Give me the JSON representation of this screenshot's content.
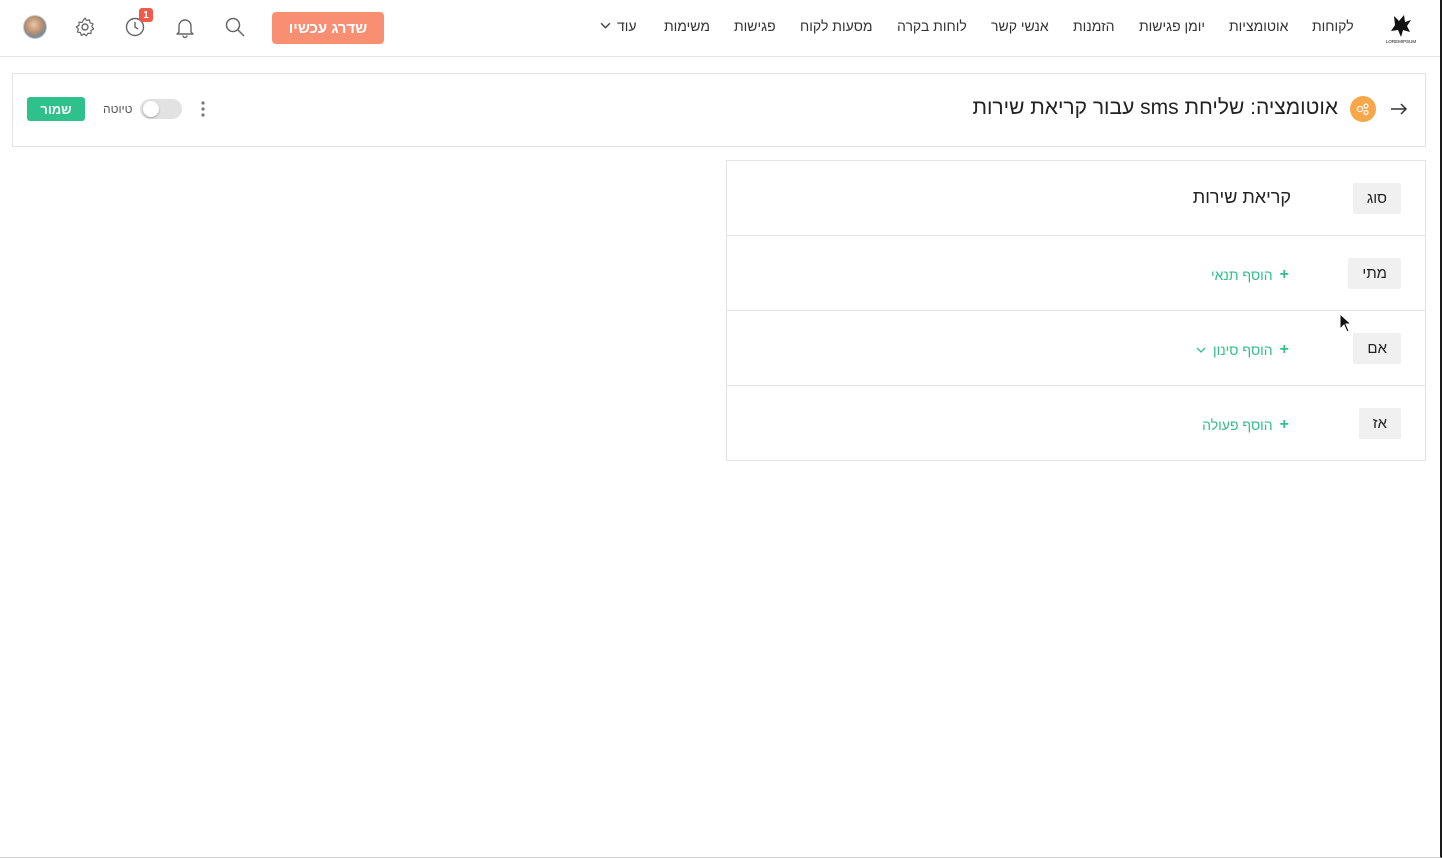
{
  "nav": {
    "items": [
      "לקוחות",
      "אוטומציות",
      "יומן פגישות",
      "הזמנות",
      "אנשי קשר",
      "לוחות בקרה",
      "מסעות לקוח",
      "פגישות",
      "משימות"
    ],
    "more_label": "עוד",
    "upgrade_label": "שדרג עכשיו",
    "notification_badge": "1",
    "logo_text": "LOREMIPSUM"
  },
  "header": {
    "title": "אוטומציה: שליחת sms עבור קריאת שירות",
    "draft_label": "טיוטה",
    "save_label": "שמור",
    "draft_enabled": false
  },
  "rules": {
    "type": {
      "label": "סוג",
      "value": "קריאת שירות"
    },
    "when": {
      "label": "מתי",
      "add_label": "הוסף תנאי"
    },
    "if": {
      "label": "אם",
      "add_label": "הוסף סינון"
    },
    "then": {
      "label": "אז",
      "add_label": "הוסף פעולה"
    }
  },
  "colors": {
    "upgrade": "#f98f72",
    "save": "#2fc18c",
    "accent_green": "#2fbf8a",
    "badge": "#ef5a4a",
    "automation_icon": "#f7a64a"
  },
  "icons": [
    "logo-icon",
    "search-icon",
    "bell-icon",
    "history-icon",
    "gear-icon",
    "avatar",
    "back-arrow-icon",
    "automation-icon",
    "kebab-icon",
    "plus-icon",
    "chevron-down-icon"
  ]
}
